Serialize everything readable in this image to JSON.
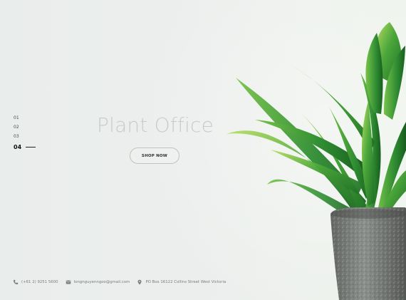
{
  "slider": {
    "items": [
      {
        "label": "01"
      },
      {
        "label": "02"
      },
      {
        "label": "03"
      },
      {
        "label": "04"
      }
    ],
    "active_index": 3
  },
  "hero": {
    "title": "Plant Office",
    "cta_label": "SHOP NOW"
  },
  "footer": {
    "phone": "(+61 2) 9251 5600",
    "email": "longnguyenngoo@gmail.com",
    "address": "PO Box 16122 Collins Street West Victoria"
  },
  "colors": {
    "background": "#eceeed",
    "title": "#c7cbc9",
    "accent_leaf": "#4fa53a",
    "pot": "#6d706d"
  },
  "icons": {
    "phone": "phone-icon",
    "email": "envelope-icon",
    "address": "location-pin-icon"
  }
}
